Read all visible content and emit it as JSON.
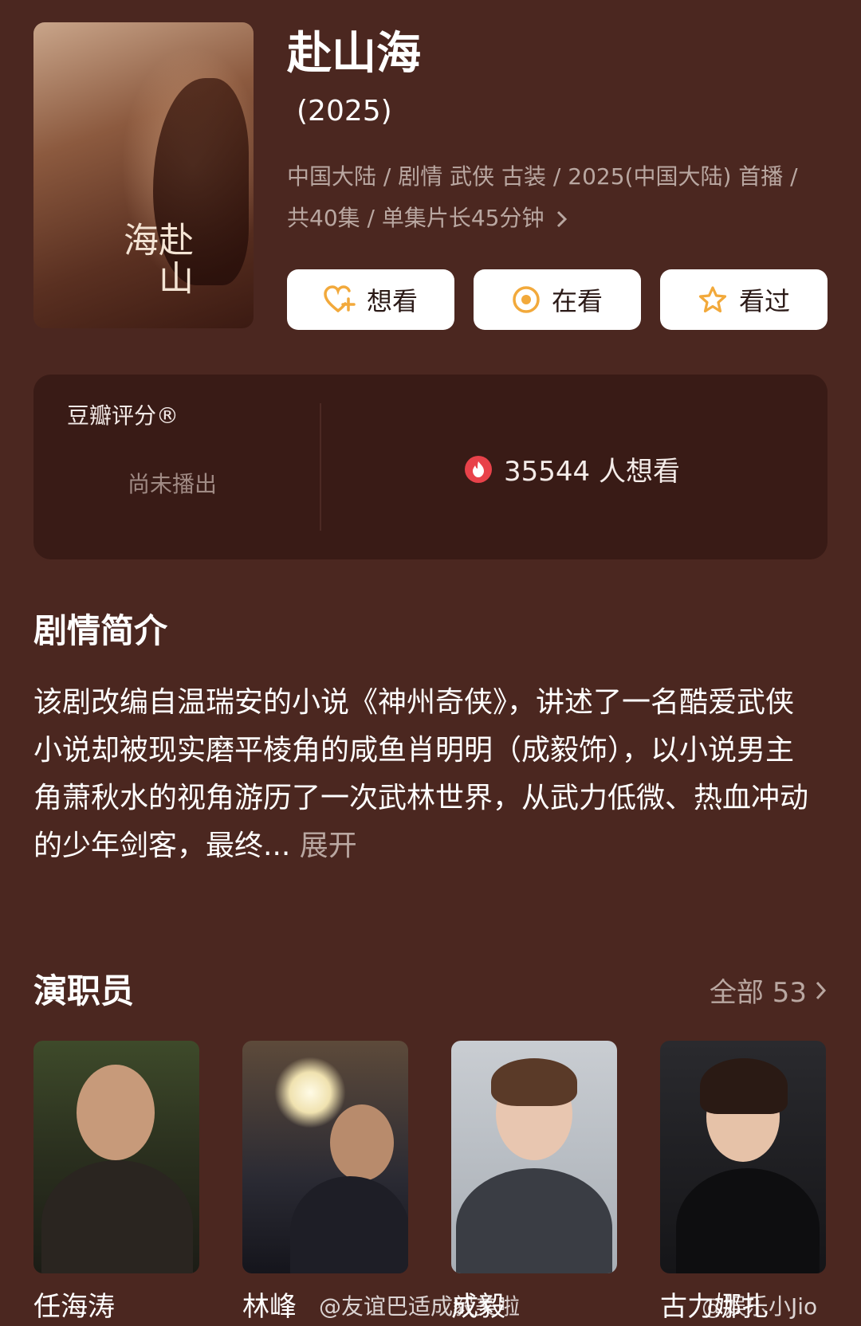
{
  "show": {
    "title": "赴山海",
    "year": "(2025)",
    "meta_line1": "中国大陆 / 剧情 武侠 古装 / 2025(中国大陆) 首播 /",
    "meta_line2": "共40集 / 单集片长45分钟",
    "poster_calligraphy": "赴山海"
  },
  "actions": [
    {
      "label": "想看",
      "icon": "heart-plus-icon"
    },
    {
      "label": "在看",
      "icon": "target-icon"
    },
    {
      "label": "看过",
      "icon": "star-icon"
    }
  ],
  "rating": {
    "label": "豆瓣评分®",
    "status": "尚未播出",
    "want_count_text": "35544 人想看",
    "flame_icon": "flame-icon"
  },
  "synopsis": {
    "section_title": "剧情简介",
    "text": "该剧改编自温瑞安的小说《神州奇侠》，讲述了一名酷爱武侠小说却被现实磨平棱角的咸鱼肖明明（成毅饰），以小说男主角萧秋水的视角游历了一次武林世界，从武力低微、热血冲动的少年剑客，最终...",
    "expand_label": "展开"
  },
  "cast": {
    "section_title": "演职员",
    "all_label": "全部 53",
    "members": [
      {
        "name": "任海涛"
      },
      {
        "name": "林峰"
      },
      {
        "name": "成毅"
      },
      {
        "name": "古力娜扎"
      }
    ]
  },
  "watermarks": {
    "left": "@友谊巴适成毅美啦",
    "right": "@娱乐小Jio"
  },
  "colors": {
    "background": "#4b2720",
    "card": "#391b16",
    "accent_orange": "#f2a93b",
    "flame_red": "#e8424a",
    "muted_text": "#b9a7a1"
  }
}
